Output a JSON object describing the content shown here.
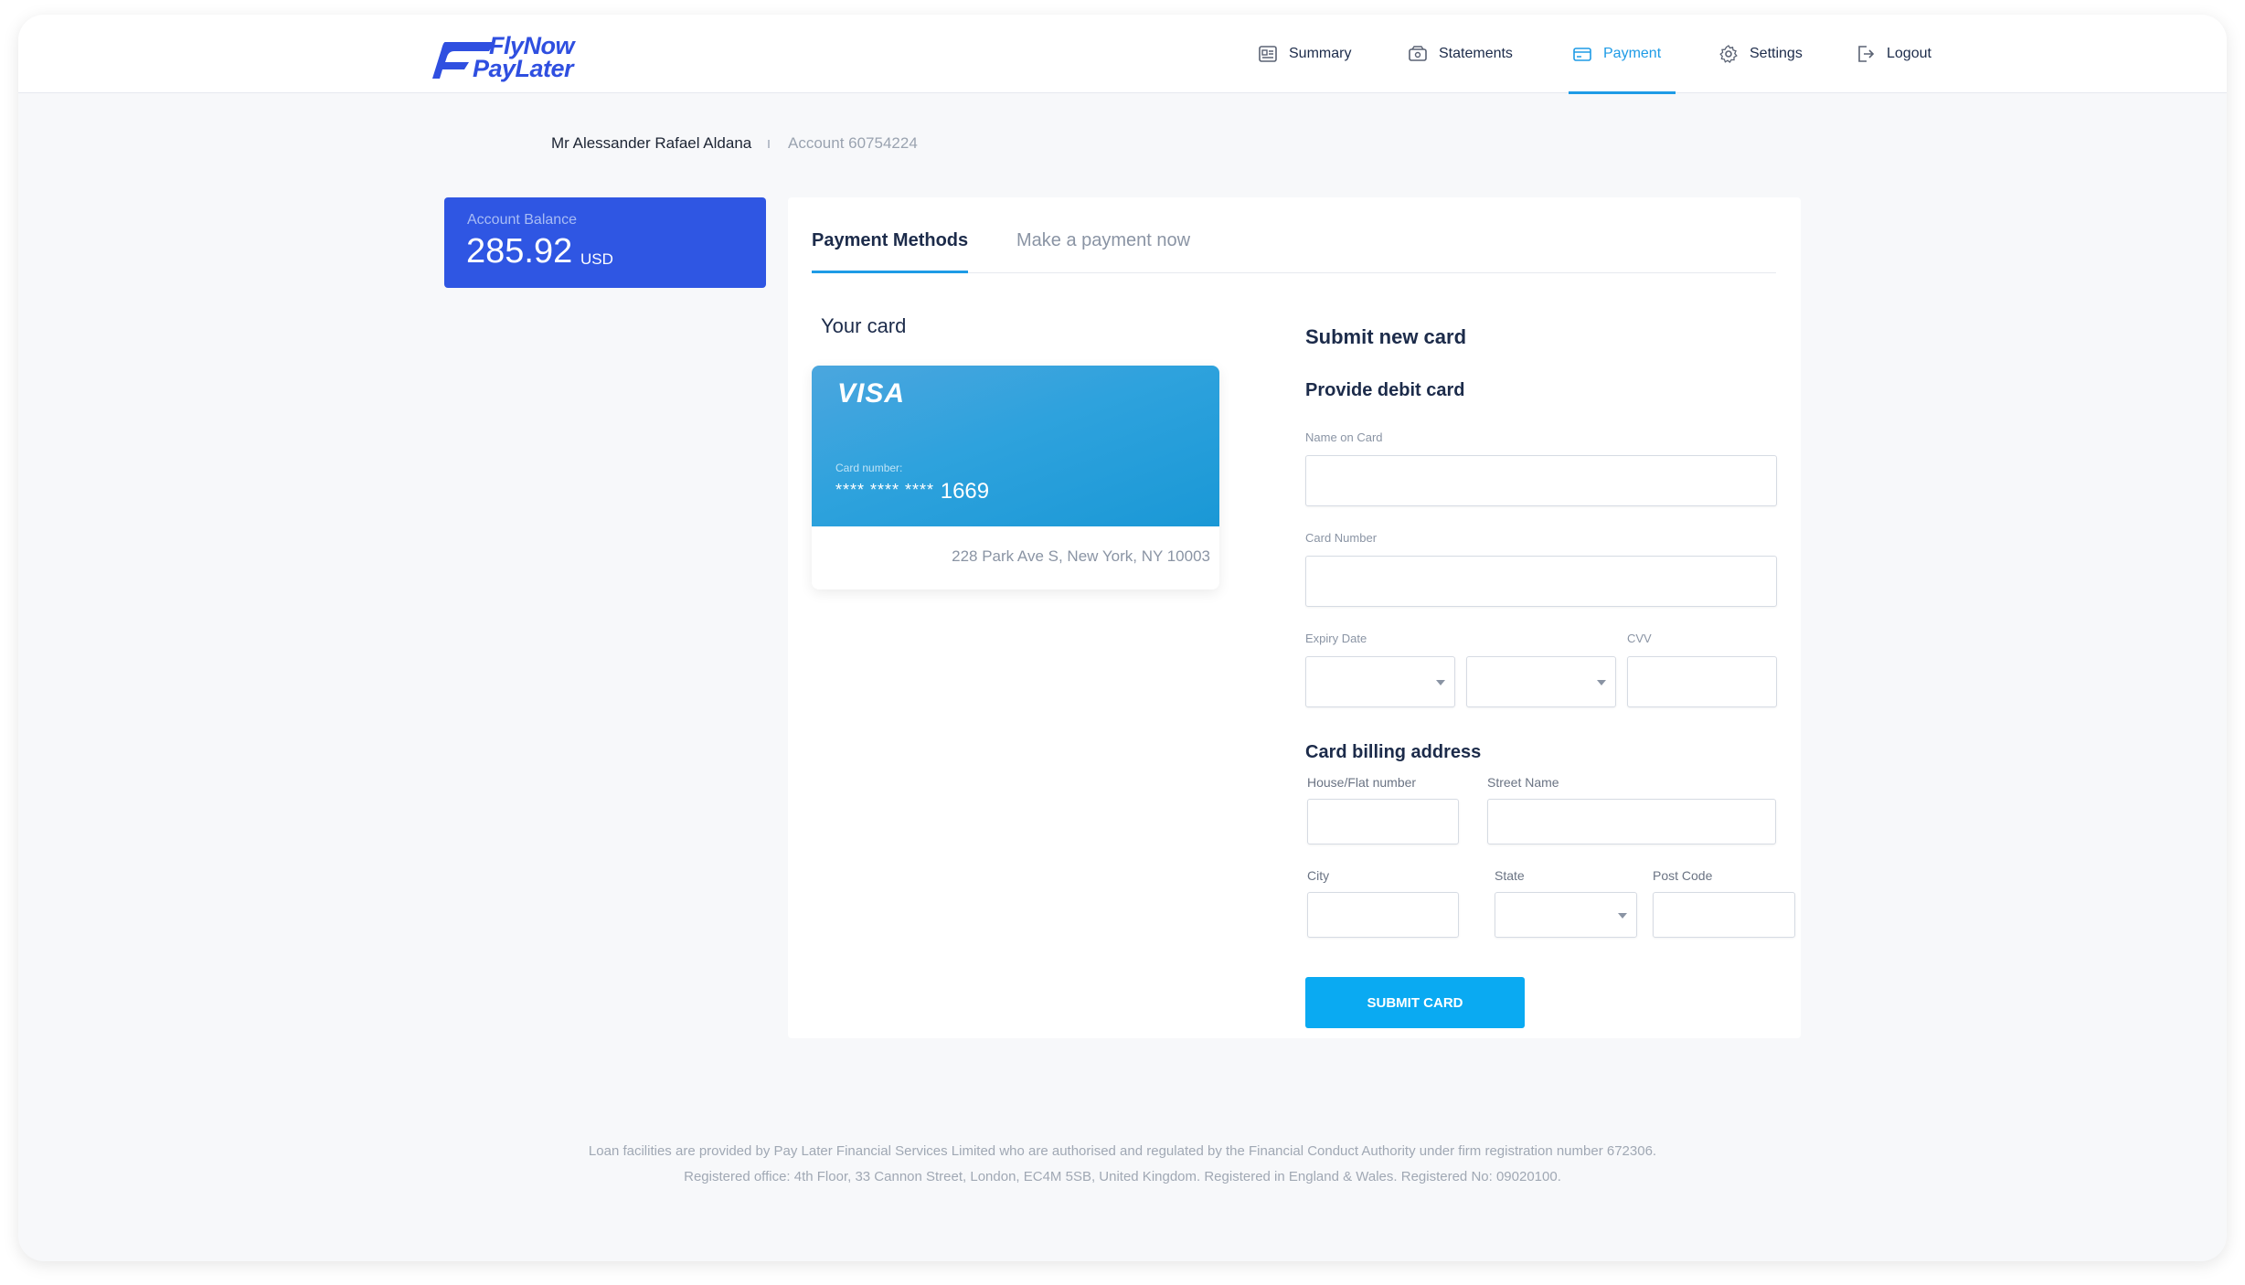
{
  "brand": {
    "line1": "FlyNow",
    "line2": "PayLater",
    "accent_color": "#2f4fe0"
  },
  "nav": {
    "items": [
      {
        "label": "Summary",
        "icon": "summary-icon"
      },
      {
        "label": "Statements",
        "icon": "statements-icon"
      },
      {
        "label": "Payment",
        "icon": "card-icon",
        "active": true
      },
      {
        "label": "Settings",
        "icon": "gear-icon"
      },
      {
        "label": "Logout",
        "icon": "logout-icon"
      }
    ],
    "active_color": "#1e9be6"
  },
  "breadcrumb": {
    "name": "Mr Alessander Rafael Aldana",
    "account": "Account 60754224"
  },
  "balance": {
    "label": "Account Balance",
    "amount": "285.92",
    "currency": "USD",
    "color": "#2f56e3"
  },
  "tabs": {
    "payment_methods": "Payment Methods",
    "make_payment": "Make a payment now"
  },
  "your_card": {
    "title": "Your card",
    "brand": "VISA",
    "number_label": "Card number:",
    "number_mask": "**** **** ****",
    "last4": "1669",
    "address": "228 Park Ave S, New York, NY 10003"
  },
  "form": {
    "title": "Submit new card",
    "subtitle": "Provide debit card",
    "name_label": "Name on Card",
    "number_label": "Card Number",
    "expiry_label": "Expiry Date",
    "cvv_label": "CVV",
    "billing_title": "Card billing address",
    "house_label": "House/Flat number",
    "street_label": "Street Name",
    "city_label": "City",
    "state_label": "State",
    "postcode_label": "Post Code",
    "submit_label": "SUBMIT CARD",
    "submit_color": "#0aaaf2"
  },
  "footer": {
    "line1": "Loan facilities are provided by Pay Later Financial Services Limited who are authorised and regulated by the Financial Conduct Authority under firm registration number 672306.",
    "line2": "Registered office: 4th Floor, 33 Cannon Street, London, EC4M 5SB, United Kingdom. Registered in England & Wales. Registered No: 09020100."
  }
}
